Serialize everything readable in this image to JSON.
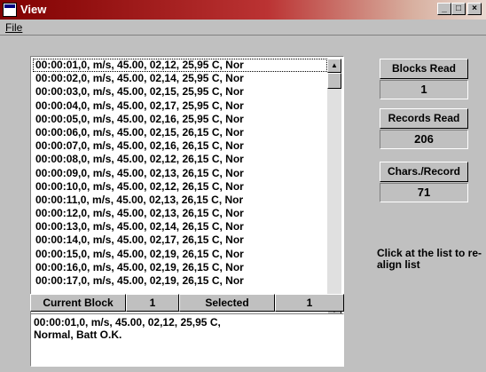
{
  "window": {
    "title": "View",
    "controls": [
      "_",
      "□",
      "×"
    ]
  },
  "menu": {
    "file_label": "File"
  },
  "list": {
    "rows": [
      "00:00:01,0,   m/s,    45.00,    02,12,  25,95 C,   Nor",
      "00:00:02,0,   m/s,    45.00,    02,14,  25,95 C,   Nor",
      "00:00:03,0,   m/s,    45.00,    02,15,  25,95 C,   Nor",
      "00:00:04,0,   m/s,    45.00,    02,17,  25,95 C,   Nor",
      "00:00:05,0,   m/s,    45.00,    02,16,  25,95 C,   Nor",
      "00:00:06,0,   m/s,    45.00,    02,15,  26,15 C,   Nor",
      "00:00:07,0,   m/s,    45.00,    02,16,  26,15 C,   Nor",
      "00:00:08,0,   m/s,    45.00,    02,12,  26,15 C,   Nor",
      "00:00:09,0,   m/s,    45.00,    02,13,  26,15 C,   Nor",
      "00:00:10,0,   m/s,    45.00,    02,12,  26,15 C,   Nor",
      "00:00:11,0,   m/s,    45.00,    02,13,  26,15 C,   Nor",
      "00:00:12,0,   m/s,    45.00,    02,13,  26,15 C,   Nor",
      "00:00:13,0,   m/s,    45.00,    02,14,  26,15 C,   Nor",
      "00:00:14,0,   m/s,    45.00,    02,17,  26,15 C,   Nor",
      "00:00:15,0,   m/s,    45.00,    02,19,  26,15 C,   Nor",
      "00:00:16,0,   m/s,    45.00,    02,19,  26,15 C,   Nor",
      "00:00:17,0,   m/s,    45.00,    02,19,  26,15 C,   Nor"
    ]
  },
  "status": {
    "current_block_label": "Current Block",
    "current_block_value": "1",
    "selected_label": "Selected",
    "selected_value": "1"
  },
  "detail": {
    "line1": "00:00:01,0,    m/s,    45.00,    02,12,  25,95 C,",
    "line2": "Normal, Batt O.K."
  },
  "stats": {
    "blocks_read_label": "Blocks Read",
    "blocks_read_value": "1",
    "records_read_label": "Records Read",
    "records_read_value": "206",
    "chars_per_record_label": "Chars./Record",
    "chars_per_record_value": "71"
  },
  "hint": "Click at the list to re-align list"
}
